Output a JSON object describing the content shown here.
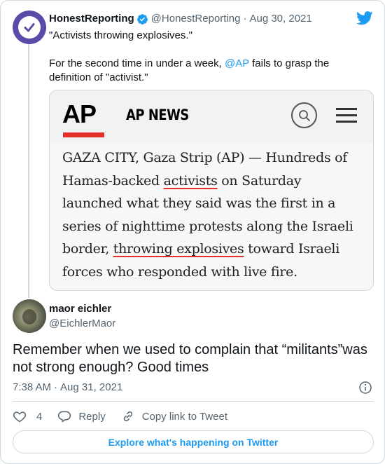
{
  "original_tweet": {
    "display_name": "HonestReporting",
    "handle": "@HonestReporting",
    "date": "Aug 30, 2021",
    "line1": "\"Activists throwing explosives.\"",
    "line2_pre": "For the second time in under a week, ",
    "line2_mention": "@AP",
    "line2_post": " fails to grasp the definition of \"activist.\"",
    "media": {
      "logo": "AP",
      "brand": "AP NEWS",
      "article_p1": "GAZA CITY, Gaza Strip (AP) — Hundreds of Hamas-backed ",
      "article_u1": "activists",
      "article_p2": " on Saturday launched what they said was the first in a series of nighttime protests along the Israeli border, ",
      "article_u2": "throwing explosives",
      "article_p3": " toward Israeli forces who responded with live fire."
    }
  },
  "reply_tweet": {
    "display_name": "maor eichler",
    "handle": "@EichlerMaor",
    "text": "Remember when we used to complain that “militants”was not strong enough? Good times",
    "time": "7:38 AM",
    "date": "Aug 31, 2021",
    "likes": "4",
    "reply_label": "Reply",
    "copy_label": "Copy link to Tweet"
  },
  "explore_label": "Explore what's happening on Twitter",
  "colors": {
    "accent": "#1d9bf0",
    "ap_red": "#e52e2e",
    "avatar_purple": "#5b4ba8"
  }
}
